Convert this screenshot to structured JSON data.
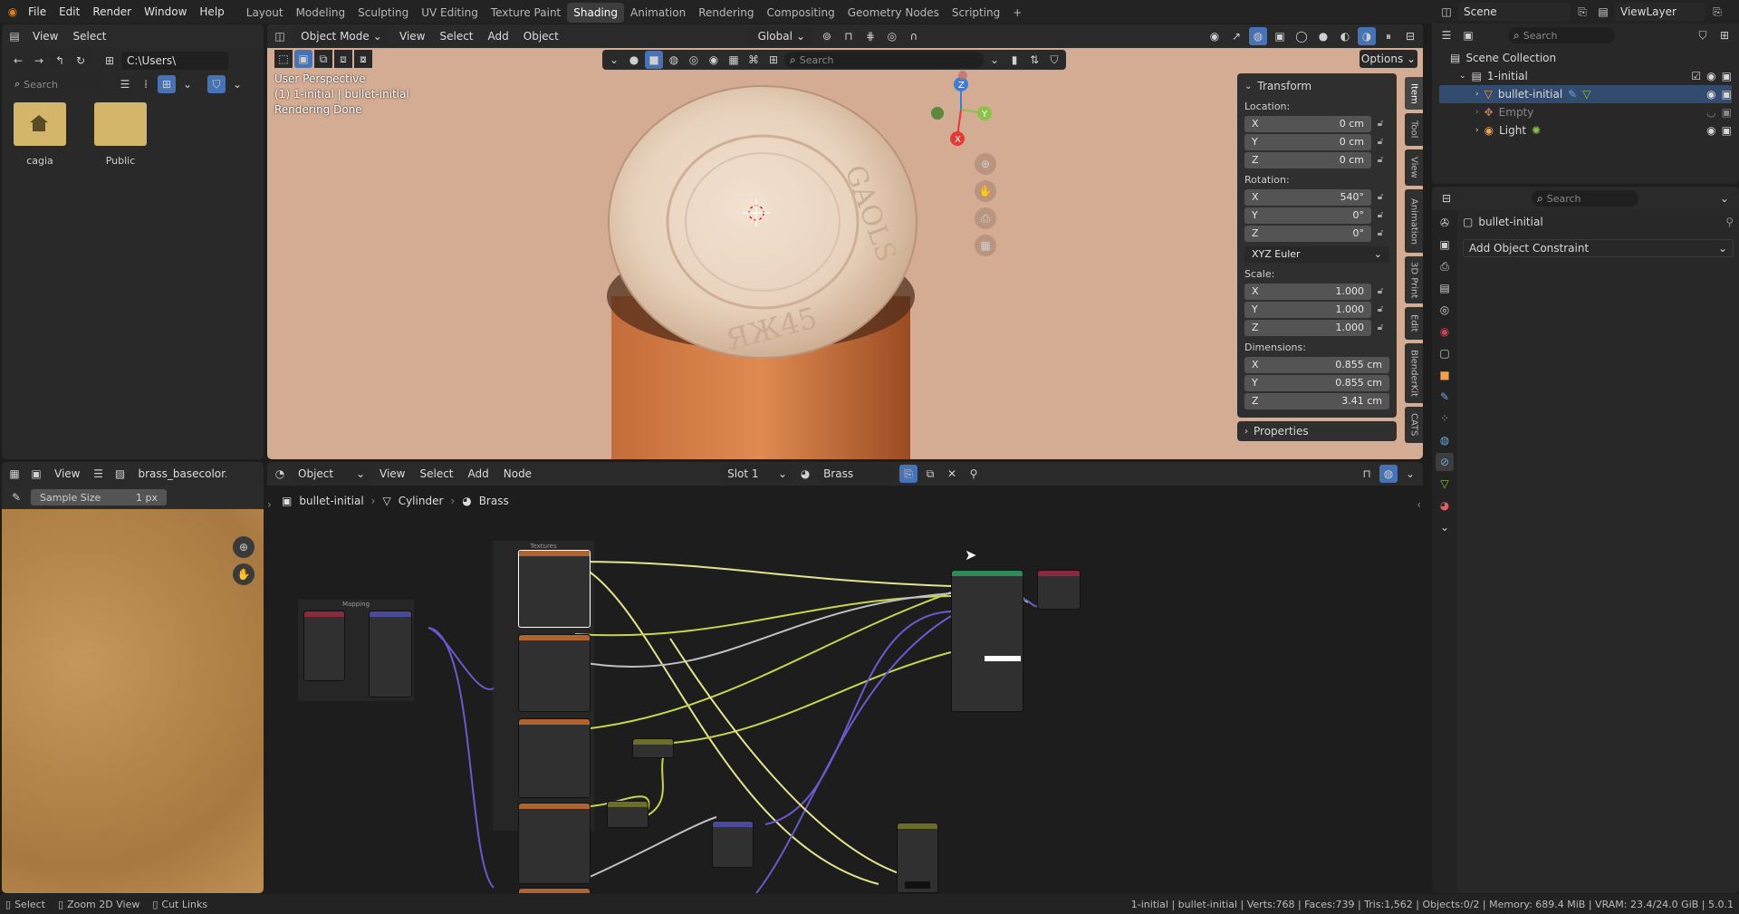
{
  "topbar": {
    "menus": [
      "File",
      "Edit",
      "Render",
      "Window",
      "Help"
    ],
    "workspaces": [
      "Layout",
      "Modeling",
      "Sculpting",
      "UV Editing",
      "Texture Paint",
      "Shading",
      "Animation",
      "Rendering",
      "Compositing",
      "Geometry Nodes",
      "Scripting"
    ],
    "active_workspace": "Shading",
    "add_tab": "+",
    "scene": "Scene",
    "view_layer": "ViewLayer"
  },
  "filebrowser": {
    "menu_view": "View",
    "menu_select": "Select",
    "path": "C:\\Users\\",
    "search_placeholder": "Search",
    "items": [
      {
        "name": "cagia",
        "kind": "home"
      },
      {
        "name": "Public",
        "kind": "folder"
      }
    ]
  },
  "imageeditor": {
    "menu_view": "View",
    "image_name": "brass_basecolor.j",
    "sample_size_label": "Sample Size",
    "sample_size_value": "1 px"
  },
  "viewport": {
    "mode": "Object Mode",
    "menus": [
      "View",
      "Select",
      "Add",
      "Object"
    ],
    "transform_orientation": "Global",
    "search_placeholder": "Search",
    "options": "Options",
    "overlay_lines": [
      "User Perspective",
      "(1) 1-initial | bullet-initial",
      "Rendering Done"
    ],
    "coin_text_top": "GAOLS",
    "coin_text_bottom": "ЯЖ45",
    "npanel": {
      "header": "Transform",
      "location_label": "Location:",
      "location": [
        [
          "X",
          "0 cm"
        ],
        [
          "Y",
          "0 cm"
        ],
        [
          "Z",
          "0 cm"
        ]
      ],
      "rotation_label": "Rotation:",
      "rotation": [
        [
          "X",
          "540°"
        ],
        [
          "Y",
          "0°"
        ],
        [
          "Z",
          "0°"
        ]
      ],
      "rotation_mode": "XYZ Euler",
      "scale_label": "Scale:",
      "scale": [
        [
          "X",
          "1.000"
        ],
        [
          "Y",
          "1.000"
        ],
        [
          "Z",
          "1.000"
        ]
      ],
      "dimensions_label": "Dimensions:",
      "dimensions": [
        [
          "X",
          "0.855 cm"
        ],
        [
          "Y",
          "0.855 cm"
        ],
        [
          "Z",
          "3.41 cm"
        ]
      ],
      "properties": "Properties"
    },
    "side_tabs": [
      "Item",
      "Tool",
      "View",
      "Animation",
      "3D Print",
      "Edit",
      "BlenderKit",
      "CATS"
    ]
  },
  "nodeeditor": {
    "type": "Object",
    "menus": [
      "View",
      "Select",
      "Add",
      "Node"
    ],
    "slot": "Slot 1",
    "material": "Brass",
    "breadcrumb": [
      "bullet-initial",
      "Cylinder",
      "Brass"
    ],
    "frames": {
      "textures": "Textures",
      "mapping": "Mapping"
    }
  },
  "outliner": {
    "search_placeholder": "Search",
    "root": "Scene Collection",
    "collection": "1-initial",
    "items": [
      "bullet-initial",
      "Empty",
      "Light"
    ]
  },
  "properties": {
    "search_placeholder": "Search",
    "object_name": "bullet-initial",
    "add_constraint": "Add Object Constraint"
  },
  "statusbar": {
    "left": [
      "Select",
      "Zoom 2D View",
      "Cut Links"
    ],
    "right": "1-initial | bullet-initial | Verts:768 | Faces:739 | Tris:1,562 | Objects:0/2 | Memory: 689.4 MiB | VRAM: 23.4/24.0 GiB | 5.0.1"
  },
  "colors": {
    "accent": "#4772b3",
    "viewport_bg": "#d4ab93",
    "node_bg": "#1d1d1d",
    "brass_tex": "#b98a4e"
  }
}
